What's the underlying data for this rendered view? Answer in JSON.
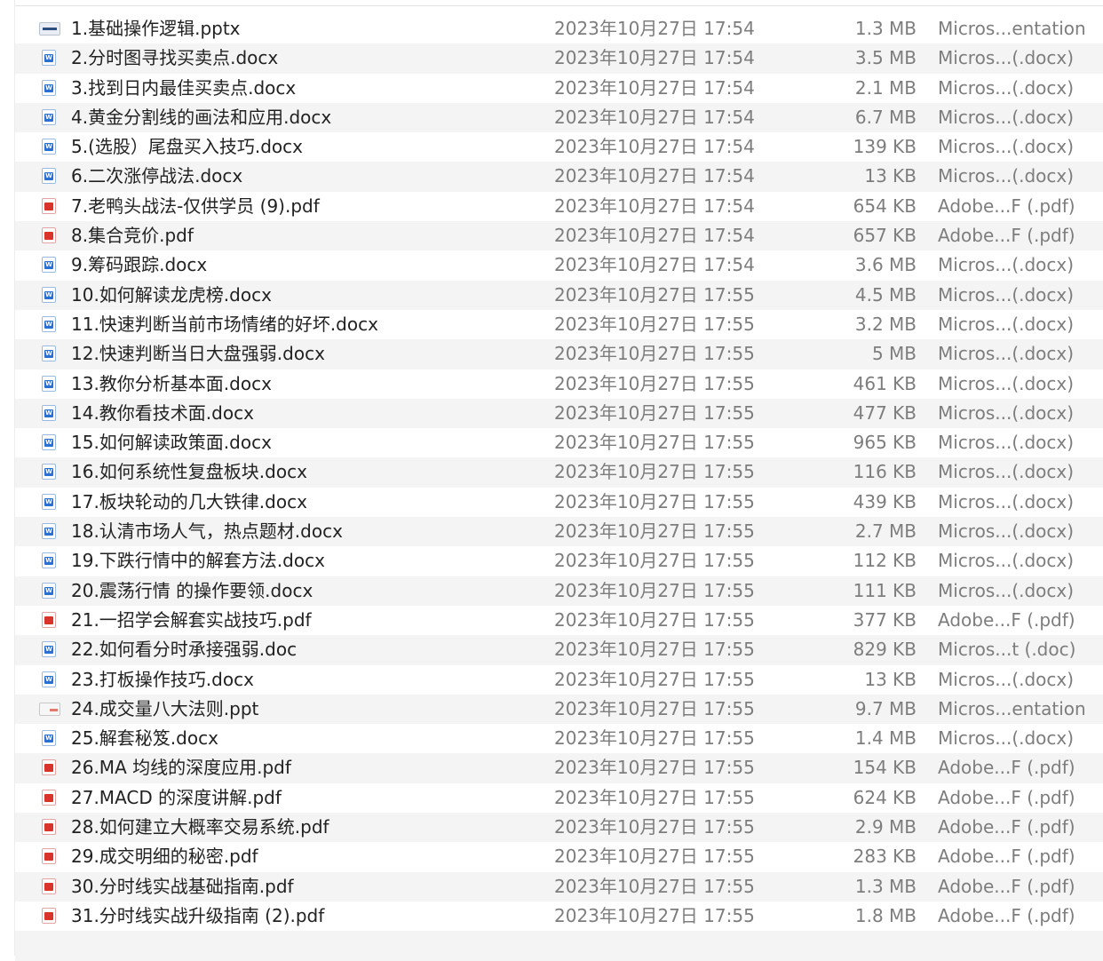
{
  "files": [
    {
      "name": "1.基础操作逻辑.pptx",
      "date": "2023年10月27日 17:54",
      "size": "1.3 MB",
      "kind": "Micros...entation",
      "icon": "slides"
    },
    {
      "name": "2.分时图寻找买卖点.docx",
      "date": "2023年10月27日 17:54",
      "size": "3.5 MB",
      "kind": "Micros...(.docx)",
      "icon": "word"
    },
    {
      "name": "3.找到日内最佳买卖点.docx",
      "date": "2023年10月27日 17:54",
      "size": "2.1 MB",
      "kind": "Micros...(.docx)",
      "icon": "word"
    },
    {
      "name": "4.黄金分割线的画法和应用.docx",
      "date": "2023年10月27日 17:54",
      "size": "6.7 MB",
      "kind": "Micros...(.docx)",
      "icon": "word"
    },
    {
      "name": "5.(选股）尾盘买入技巧.docx",
      "date": "2023年10月27日 17:54",
      "size": "139 KB",
      "kind": "Micros...(.docx)",
      "icon": "word"
    },
    {
      "name": "6.二次涨停战法.docx",
      "date": "2023年10月27日 17:54",
      "size": "13 KB",
      "kind": "Micros...(.docx)",
      "icon": "word"
    },
    {
      "name": "7.老鸭头战法-仅供学员 (9).pdf",
      "date": "2023年10月27日 17:54",
      "size": "654 KB",
      "kind": "Adobe...F (.pdf)",
      "icon": "pdf"
    },
    {
      "name": "8.集合竞价.pdf",
      "date": "2023年10月27日 17:54",
      "size": "657 KB",
      "kind": "Adobe...F (.pdf)",
      "icon": "pdf"
    },
    {
      "name": "9.筹码跟踪.docx",
      "date": "2023年10月27日 17:54",
      "size": "3.6 MB",
      "kind": "Micros...(.docx)",
      "icon": "word"
    },
    {
      "name": "10.如何解读龙虎榜.docx",
      "date": "2023年10月27日 17:55",
      "size": "4.5 MB",
      "kind": "Micros...(.docx)",
      "icon": "word"
    },
    {
      "name": "11.快速判断当前市场情绪的好坏.docx",
      "date": "2023年10月27日 17:55",
      "size": "3.2 MB",
      "kind": "Micros...(.docx)",
      "icon": "word"
    },
    {
      "name": "12.快速判断当日大盘强弱.docx",
      "date": "2023年10月27日 17:55",
      "size": "5 MB",
      "kind": "Micros...(.docx)",
      "icon": "word"
    },
    {
      "name": "13.教你分析基本面.docx",
      "date": "2023年10月27日 17:55",
      "size": "461 KB",
      "kind": "Micros...(.docx)",
      "icon": "word"
    },
    {
      "name": "14.教你看技术面.docx",
      "date": "2023年10月27日 17:55",
      "size": "477 KB",
      "kind": "Micros...(.docx)",
      "icon": "word"
    },
    {
      "name": "15.如何解读政策面.docx",
      "date": "2023年10月27日 17:55",
      "size": "965 KB",
      "kind": "Micros...(.docx)",
      "icon": "word"
    },
    {
      "name": "16.如何系统性复盘板块.docx",
      "date": "2023年10月27日 17:55",
      "size": "116 KB",
      "kind": "Micros...(.docx)",
      "icon": "word"
    },
    {
      "name": "17.板块轮动的几大铁律.docx",
      "date": "2023年10月27日 17:55",
      "size": "439 KB",
      "kind": "Micros...(.docx)",
      "icon": "word"
    },
    {
      "name": "18.认清市场人气，热点题材.docx",
      "date": "2023年10月27日 17:55",
      "size": "2.7 MB",
      "kind": "Micros...(.docx)",
      "icon": "word"
    },
    {
      "name": "19.下跌行情中的解套方法.docx",
      "date": "2023年10月27日 17:55",
      "size": "112 KB",
      "kind": "Micros...(.docx)",
      "icon": "word"
    },
    {
      "name": "20.震荡行情 的操作要领.docx",
      "date": "2023年10月27日 17:55",
      "size": "111 KB",
      "kind": "Micros...(.docx)",
      "icon": "word"
    },
    {
      "name": "21.一招学会解套实战技巧.pdf",
      "date": "2023年10月27日 17:55",
      "size": "377 KB",
      "kind": "Adobe...F (.pdf)",
      "icon": "pdf"
    },
    {
      "name": "22.如何看分时承接强弱.doc",
      "date": "2023年10月27日 17:55",
      "size": "829 KB",
      "kind": "Micros...t (.doc)",
      "icon": "word"
    },
    {
      "name": "23.打板操作技巧.docx",
      "date": "2023年10月27日 17:55",
      "size": "13 KB",
      "kind": "Micros...(.docx)",
      "icon": "word"
    },
    {
      "name": "24.成交量八大法则.ppt",
      "date": "2023年10月27日 17:55",
      "size": "9.7 MB",
      "kind": "Micros...entation",
      "icon": "slides-light"
    },
    {
      "name": "25.解套秘笈.docx",
      "date": "2023年10月27日 17:55",
      "size": "1.4 MB",
      "kind": "Micros...(.docx)",
      "icon": "word"
    },
    {
      "name": "26.MA 均线的深度应用.pdf",
      "date": "2023年10月27日 17:55",
      "size": "154 KB",
      "kind": "Adobe...F (.pdf)",
      "icon": "pdf"
    },
    {
      "name": "27.MACD 的深度讲解.pdf",
      "date": "2023年10月27日 17:55",
      "size": "624 KB",
      "kind": "Adobe...F (.pdf)",
      "icon": "pdf"
    },
    {
      "name": "28.如何建立大概率交易系统.pdf",
      "date": "2023年10月27日 17:55",
      "size": "2.9 MB",
      "kind": "Adobe...F (.pdf)",
      "icon": "pdf"
    },
    {
      "name": "29.成交明细的秘密.pdf",
      "date": "2023年10月27日 17:55",
      "size": "283 KB",
      "kind": "Adobe...F (.pdf)",
      "icon": "pdf"
    },
    {
      "name": "30.分时线实战基础指南.pdf",
      "date": "2023年10月27日 17:55",
      "size": "1.3 MB",
      "kind": "Adobe...F (.pdf)",
      "icon": "pdf"
    },
    {
      "name": "31.分时线实战升级指南 (2).pdf",
      "date": "2023年10月27日 17:55",
      "size": "1.8 MB",
      "kind": "Adobe...F (.pdf)",
      "icon": "pdf"
    }
  ]
}
